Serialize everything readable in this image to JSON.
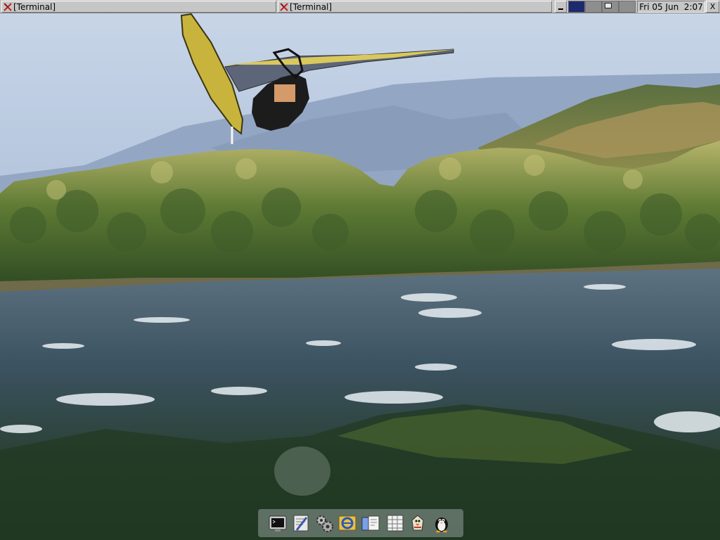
{
  "taskbar": {
    "tasks": [
      {
        "label": "[Terminal]"
      },
      {
        "label": "[Terminal]"
      }
    ],
    "clock": "Fri 05 Jun  2:07",
    "close_label": "X"
  },
  "wallpaper": {
    "description_icon": "windsurfer-river-photo"
  },
  "dock": {
    "items": [
      {
        "icon": "terminal-icon"
      },
      {
        "icon": "text-editor-icon"
      },
      {
        "icon": "settings-gears-icon"
      },
      {
        "icon": "web-browser-icon"
      },
      {
        "icon": "documents-icon"
      },
      {
        "icon": "spreadsheet-icon"
      },
      {
        "icon": "mail-icon"
      },
      {
        "icon": "penguin-icon"
      }
    ]
  }
}
